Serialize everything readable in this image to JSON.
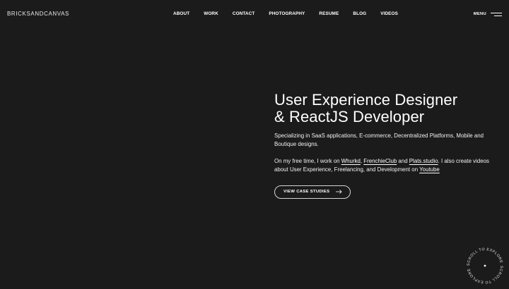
{
  "header": {
    "logo": "BRICKSANDCANVAS",
    "nav": {
      "about": "ABOUT",
      "work": "WORK",
      "contact": "CONTACT",
      "photography": "PHOTOGRAPHY",
      "resume": "RESUME",
      "blog": "BLOG",
      "videos": "VIDEOS"
    },
    "menu_label": "MENU"
  },
  "hero": {
    "title_line1": "User Experience Designer",
    "title_line2": "& ReactJS Developer",
    "intro": "Specializing in SaaS applications, E-commerce, Decentralized Platforms, Mobile and Boutique designs.",
    "free_time": {
      "prefix": "On my free time, I work on ",
      "link1": "Whurkd",
      "sep1": ", ",
      "link2": "FrenchieClub",
      "sep2": " and ",
      "link3": "Plats.studio",
      "mid": ". I also create videos about User Experience, Freelancing, and Development on ",
      "link4": "Youtube"
    },
    "cta_label": "VIEW CASE STUDIES"
  },
  "scroll_badge": {
    "text": "SCROLL TO EXPLORE"
  },
  "colors": {
    "background": "#1b1b1b",
    "text": "#ffffff",
    "border": "#d6d6d6"
  },
  "icons": {
    "cta_icon": "arrow-right-icon",
    "menu_icon": "hamburger-icon",
    "badge_icon": "dot-icon"
  }
}
